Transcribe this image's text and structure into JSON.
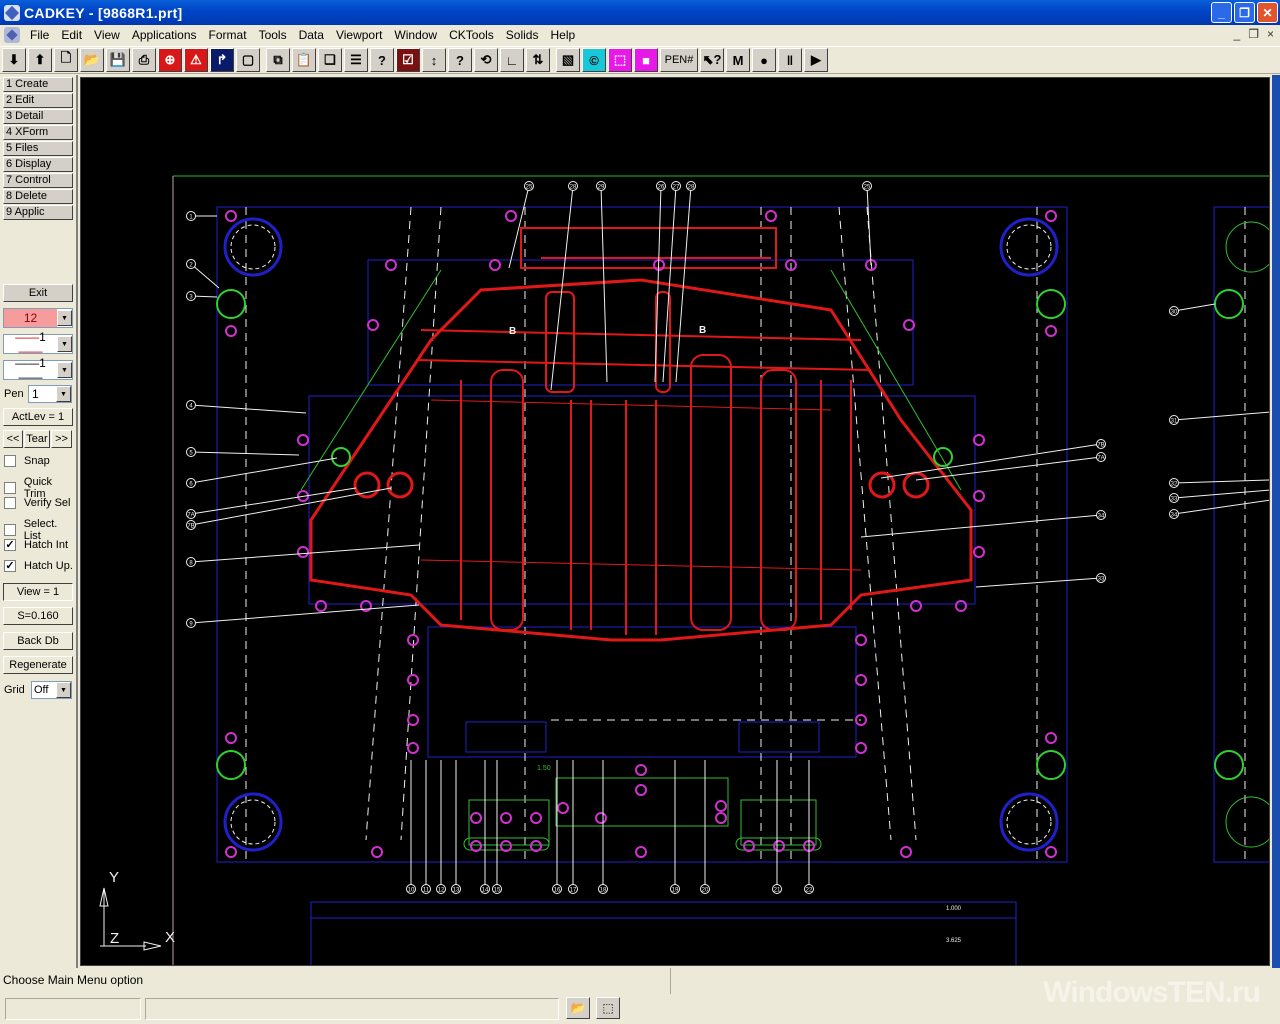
{
  "window": {
    "title": "CADKEY - [9868R1.prt]",
    "controls": [
      "minimize",
      "restore",
      "close"
    ]
  },
  "menubar": {
    "items": [
      {
        "label": "File",
        "accel": "F"
      },
      {
        "label": "Edit",
        "accel": "E"
      },
      {
        "label": "View",
        "accel": "V"
      },
      {
        "label": "Applications",
        "accel": "A"
      },
      {
        "label": "Format",
        "accel": "o"
      },
      {
        "label": "Tools",
        "accel": "T"
      },
      {
        "label": "Data",
        "accel": "D"
      },
      {
        "label": "Viewport",
        "accel": "p"
      },
      {
        "label": "Window",
        "accel": "W"
      },
      {
        "label": "CKTools",
        "accel": "K"
      },
      {
        "label": "Solids",
        "accel": "S"
      },
      {
        "label": "Help",
        "accel": "H"
      }
    ],
    "mdi_controls": [
      "_",
      "❐",
      "×"
    ]
  },
  "toolbar": {
    "buttons": [
      {
        "name": "arrow-down-icon",
        "glyph": "⬇",
        "style": ""
      },
      {
        "name": "arrow-up-icon",
        "glyph": "⬆",
        "style": ""
      },
      {
        "name": "new-file-icon",
        "glyph": "🗋",
        "style": ""
      },
      {
        "name": "open-folder-icon",
        "glyph": "📂",
        "style": ""
      },
      {
        "name": "save-icon",
        "glyph": "💾",
        "style": ""
      },
      {
        "name": "print-icon",
        "glyph": "⎙",
        "style": ""
      },
      {
        "name": "crosshair-target-icon",
        "glyph": "⊕",
        "style": "red"
      },
      {
        "name": "warning-triangle-icon",
        "glyph": "⚠",
        "style": "red"
      },
      {
        "name": "trim-path-icon",
        "glyph": "↱",
        "style": "navy"
      },
      {
        "name": "select-window-icon",
        "glyph": "▢",
        "style": ""
      },
      {
        "name": "copy-icon",
        "glyph": "⧉",
        "style": ""
      },
      {
        "name": "paste-icon",
        "glyph": "📋",
        "style": ""
      },
      {
        "name": "layers-icon",
        "glyph": "❏",
        "style": ""
      },
      {
        "name": "list-icon",
        "glyph": "☰",
        "style": ""
      },
      {
        "name": "query-dashed-icon",
        "glyph": "?",
        "style": ""
      },
      {
        "name": "checklist-icon",
        "glyph": "☑",
        "style": "darkred"
      },
      {
        "name": "measure-distance-icon",
        "glyph": "↕",
        "style": ""
      },
      {
        "name": "query-add-icon",
        "glyph": "?",
        "style": ""
      },
      {
        "name": "rotate-view-icon",
        "glyph": "⟲",
        "style": ""
      },
      {
        "name": "axis-icon",
        "glyph": "∟",
        "style": ""
      },
      {
        "name": "dimension-icon",
        "glyph": "⇅",
        "style": ""
      },
      {
        "name": "hatch-brush-icon",
        "glyph": "▧",
        "style": ""
      },
      {
        "name": "render-icon",
        "glyph": "©",
        "style": "cyan"
      },
      {
        "name": "cube-wireframe-icon",
        "glyph": "⬚",
        "style": "magenta"
      },
      {
        "name": "color-cube-icon",
        "glyph": "■",
        "style": "magenta"
      },
      {
        "name": "pen-number-button",
        "glyph": "PEN#",
        "style": "wide"
      },
      {
        "name": "pointer-help-icon",
        "glyph": "⬉?",
        "style": ""
      },
      {
        "name": "macro-icon",
        "glyph": "M",
        "style": ""
      },
      {
        "name": "macro-record-icon",
        "glyph": "●",
        "style": ""
      },
      {
        "name": "macro-pause-icon",
        "glyph": "‖",
        "style": ""
      },
      {
        "name": "macro-play-icon",
        "glyph": "▶",
        "style": ""
      }
    ]
  },
  "sidepanel": {
    "main_menu": [
      "1 Create",
      "2 Edit",
      "3 Detail",
      "4 XForm",
      "5 Files",
      "6 Display",
      "7 Control",
      "8 Delete",
      "9 Applic"
    ],
    "exit_label": "Exit",
    "color_value": "12",
    "color_swatch": "#f79c9c",
    "line_type_value": "1",
    "line_width_value": "1",
    "pen_label": "Pen",
    "pen_value": "1",
    "actlev_label": "ActLev =  1",
    "prev_label": "<<",
    "tear_label": "Tear",
    "next_label": ">>",
    "checkboxes": [
      {
        "label": "Snap",
        "checked": false
      },
      {
        "label": "Quick Trim",
        "checked": false
      },
      {
        "label": "Verify Sel",
        "checked": false
      },
      {
        "label": "Select. List",
        "checked": false
      },
      {
        "label": "Hatch Int",
        "checked": true
      },
      {
        "label": "Hatch Up.",
        "checked": true
      }
    ],
    "view_label": "View =  1",
    "scale_label": "S=0.160",
    "backdb_label": "Back Db",
    "regenerate_label": "Regenerate",
    "grid_label": "Grid",
    "grid_value": "Off"
  },
  "canvas": {
    "axis_labels": {
      "y": "Y",
      "z": "Z",
      "x": "X"
    },
    "colors": {
      "background": "#000000",
      "border_green": "#20c020",
      "outline_blue": "#2020c8",
      "part_red": "#e01818",
      "hole_magenta": "#d030d0",
      "centerline_white": "#f0f0f0",
      "dowel_green": "#30d030"
    },
    "balloons_left": [
      "1",
      "2",
      "3",
      "4",
      "5",
      "6",
      "7A",
      "7B",
      "8",
      "9"
    ],
    "balloons_top": [
      "25",
      "28",
      "29",
      "26",
      "27",
      "28",
      "25"
    ],
    "balloons_bottom": [
      "10",
      "11",
      "12",
      "13",
      "14",
      "15",
      "16",
      "17",
      "18",
      "19",
      "20",
      "21",
      "22"
    ],
    "balloons_right": [
      "7B",
      "7A",
      "34",
      "33"
    ],
    "balloons_far_right": [
      "30",
      "31",
      "32",
      "33",
      "34"
    ],
    "section_labels": [
      "B",
      "B"
    ],
    "dim_text": [
      "1.50",
      "1.000",
      "3.625"
    ]
  },
  "statusbar": {
    "message": "Choose Main Menu option",
    "watermark": "WindowsTEN.ru"
  }
}
